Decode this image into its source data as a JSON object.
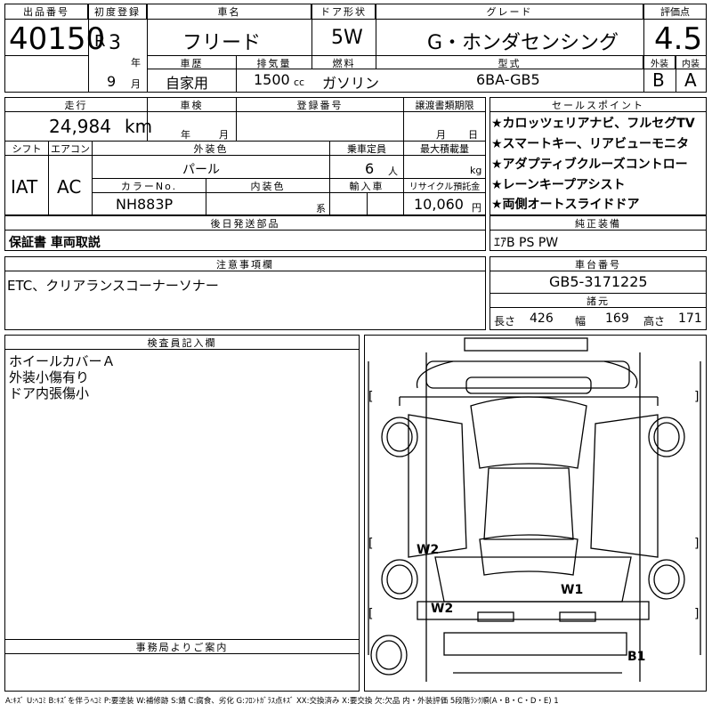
{
  "header": {
    "lot_label": "出品番号",
    "lot_no": "40150",
    "first_reg_label": "初度登録",
    "era": "R",
    "year": "3",
    "year_unit": "年",
    "month": "9",
    "month_unit": "月",
    "car_name_label": "車名",
    "car_name": "フリード",
    "door_label": "ドア形状",
    "door": "5W",
    "grade_label": "グレード",
    "grade": "G・ホンダセンシング",
    "score_label": "評価点",
    "score": "4.5",
    "ext_label": "外装",
    "ext": "B",
    "int_label": "内装",
    "int": "A",
    "history_label": "車歴",
    "history": "自家用",
    "disp_label": "排気量",
    "disp": "1500",
    "disp_unit": "cc",
    "fuel_label": "燃料",
    "fuel": "ガソリン",
    "model_label": "型式",
    "model": "6BA-GB5"
  },
  "row2": {
    "mileage_label": "走行",
    "mileage": "24,984",
    "mileage_unit": "km",
    "inspection_label": "車検",
    "insp_year_unit": "年",
    "insp_month_unit": "月",
    "reg_no_label": "登録番号",
    "transfer_label": "譲渡書類期限",
    "transfer_month_unit": "月",
    "transfer_day_unit": "日",
    "shift_label": "シフト",
    "shift": "IAT",
    "ac_label": "エアコン",
    "ac": "AC",
    "ext_color_label": "外装色",
    "ext_color": "パール",
    "seats_label": "乗車定員",
    "seats": "6",
    "seats_unit": "人",
    "load_label": "最大積載量",
    "load_unit": "kg",
    "color_no_label": "カラーNo.",
    "color_no": "NH883P",
    "int_color_label": "内装色",
    "int_color_unit": "系",
    "import_label": "輸入車",
    "recycle_label": "リサイクル預託金",
    "recycle": "10,060",
    "recycle_unit": "円"
  },
  "sales_points": {
    "label": "セールスポイント",
    "items": [
      "★カロッツェリアナビ、フルセグTV",
      "★スマートキー、リアビューモニタ",
      "★アダプティブクルーズコントロー",
      "★レーンキープアシスト",
      "★両側オートスライドドア"
    ]
  },
  "later_parts": {
    "label": "後日発送部品",
    "text": "保証書 車両取説"
  },
  "genuine": {
    "label": "純正装備",
    "text": "ｴｱB PS PW"
  },
  "notes": {
    "label": "注意事項欄",
    "text": "ETC、クリアランスコーナーソナー"
  },
  "chassis": {
    "label": "車台番号",
    "value": "GB5-3171225"
  },
  "dims": {
    "label": "諸元",
    "len_label": "長さ",
    "len": "426",
    "wid_label": "幅",
    "wid": "169",
    "hei_label": "高さ",
    "hei": "171"
  },
  "inspector": {
    "label": "検査員記入欄",
    "lines": [
      "ホイールカバーＡ",
      "外装小傷有り",
      "ドア内張傷小"
    ]
  },
  "office": {
    "label": "事務局よりご案内"
  },
  "diagram": {
    "marks": [
      "W2",
      "W1",
      "W2",
      "B1"
    ],
    "brackets": [
      "[",
      "]",
      "[",
      "]",
      "[",
      "]",
      "[",
      "]",
      "[",
      "]",
      "[",
      "]"
    ]
  },
  "legend": "A:ｷｽﾞ U:ﾍｺﾐ B:ｷｽﾞを伴うﾍｺﾐ P:要塗装 W:補修跡 S:錆 C:腐食、劣化 G:ﾌﾛﾝﾄｶﾞﾗｽ点ｷｽﾞ XX:交換済み X:要交換 欠:欠品 内・外装評価 5段階ﾗﾝｸ順(A・B・C・D・E) 1"
}
